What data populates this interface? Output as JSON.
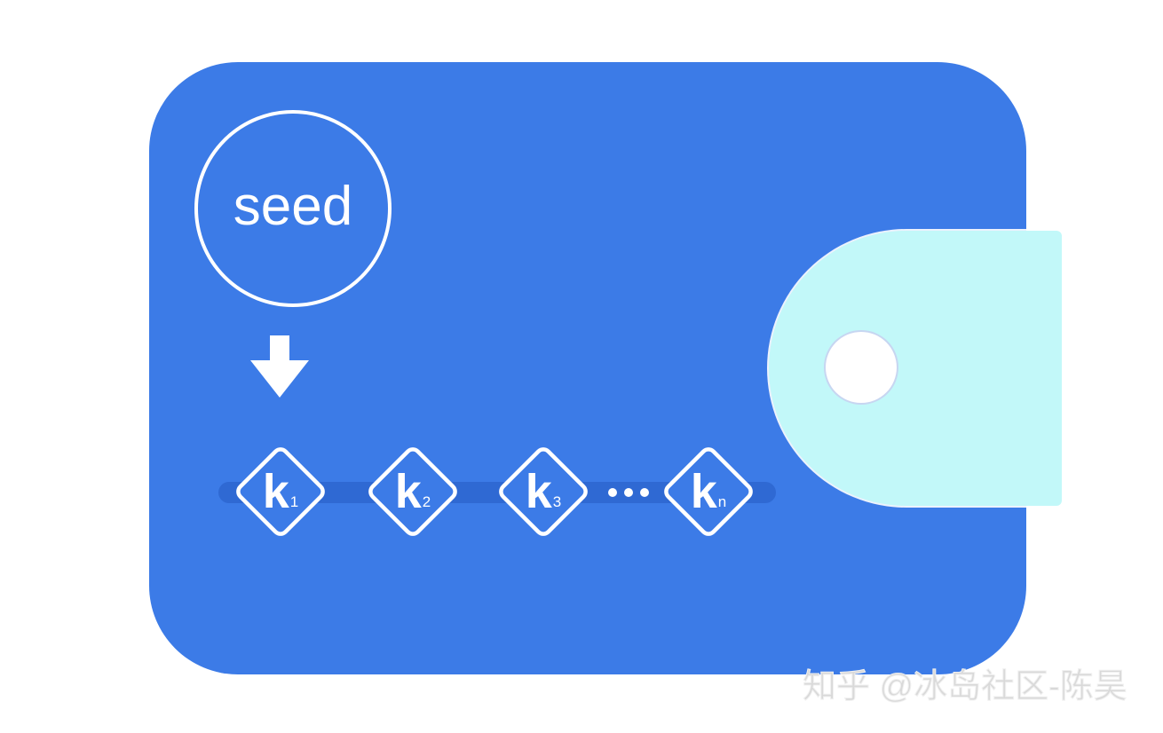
{
  "diagram": {
    "seed_label": "seed",
    "keys": [
      {
        "main": "k",
        "sub": "1"
      },
      {
        "main": "k",
        "sub": "2"
      },
      {
        "main": "k",
        "sub": "3"
      },
      {
        "main": "k",
        "sub": "n"
      }
    ],
    "colors": {
      "wallet_body": "#3c7be7",
      "wallet_flap": "#c2f8f9",
      "key_track": "#2f69d3",
      "stroke": "#ffffff"
    }
  },
  "watermark": {
    "text": "知乎 @冰岛社区-陈昊"
  }
}
